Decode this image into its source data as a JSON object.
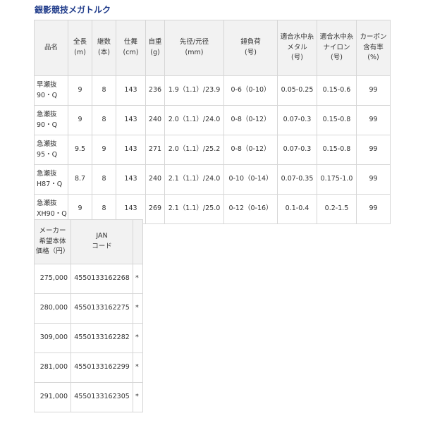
{
  "title": "銀影競技メガトルク",
  "spec_table": {
    "headers": [
      [
        "品名"
      ],
      [
        "全長",
        "(m)"
      ],
      [
        "継数",
        "(本)"
      ],
      [
        "仕舞",
        "(cm)"
      ],
      [
        "自重",
        "(g)"
      ],
      [
        "先径/元径",
        "(mm)"
      ],
      [
        "錘負荷",
        "(号)"
      ],
      [
        "適合水中糸",
        "メタル",
        "(号)"
      ],
      [
        "適合水中糸",
        "ナイロン",
        "(号)"
      ],
      [
        "カーボン",
        "含有率",
        "(%)"
      ]
    ],
    "rows": [
      {
        "name": [
          "早瀬抜",
          "90・Q"
        ],
        "length": "9",
        "pieces": "8",
        "closed": "143",
        "weight": "236",
        "diameter": "1.9（1.1）/23.9",
        "sinker": "0-6（0-10）",
        "metal": "0.05-0.25",
        "nylon": "0.15-0.6",
        "carbon": "99"
      },
      {
        "name": [
          "急瀬抜",
          "90・Q"
        ],
        "length": "9",
        "pieces": "8",
        "closed": "143",
        "weight": "240",
        "diameter": "2.0（1.1）/24.0",
        "sinker": "0-8（0-12）",
        "metal": "0.07-0.3",
        "nylon": "0.15-0.8",
        "carbon": "99"
      },
      {
        "name": [
          "急瀬抜",
          "95・Q"
        ],
        "length": "9.5",
        "pieces": "9",
        "closed": "143",
        "weight": "271",
        "diameter": "2.0（1.1）/25.2",
        "sinker": "0-8（0-12）",
        "metal": "0.07-0.3",
        "nylon": "0.15-0.8",
        "carbon": "99"
      },
      {
        "name": [
          "急瀬抜",
          "H87・Q"
        ],
        "length": "8.7",
        "pieces": "8",
        "closed": "143",
        "weight": "240",
        "diameter": "2.1（1.1）/24.0",
        "sinker": "0-10（0-14）",
        "metal": "0.07-0.35",
        "nylon": "0.175-1.0",
        "carbon": "99"
      },
      {
        "name": [
          "急瀬抜",
          "XH90・Q"
        ],
        "length": "9",
        "pieces": "8",
        "closed": "143",
        "weight": "269",
        "diameter": "2.1（1.1）/25.0",
        "sinker": "0-12（0-16）",
        "metal": "0.1-0.4",
        "nylon": "0.2-1.5",
        "carbon": "99"
      }
    ]
  },
  "price_table": {
    "headers": [
      [
        "メーカー",
        "希望本体",
        "価格（円）"
      ],
      [
        "JAN",
        "コード"
      ],
      [
        ""
      ]
    ],
    "rows": [
      {
        "price": "275,000",
        "jan": "4550133162268",
        "note": "*"
      },
      {
        "price": "280,000",
        "jan": "4550133162275",
        "note": "*"
      },
      {
        "price": "309,000",
        "jan": "4550133162282",
        "note": "*"
      },
      {
        "price": "281,000",
        "jan": "4550133162299",
        "note": "*"
      },
      {
        "price": "291,000",
        "jan": "4550133162305",
        "note": "*"
      }
    ]
  }
}
